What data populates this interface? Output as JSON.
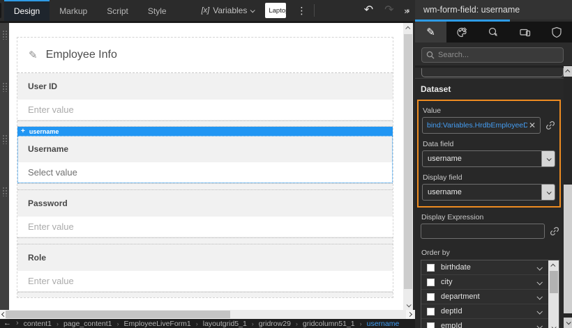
{
  "toolbar": {
    "tabs": [
      {
        "label": "Design",
        "active": true
      },
      {
        "label": "Markup",
        "active": false
      },
      {
        "label": "Script",
        "active": false
      },
      {
        "label": "Style",
        "active": false
      }
    ],
    "variables": {
      "icon_text": "[x]",
      "label": "Variables"
    },
    "device_select": {
      "value": "Laptop with MDPI Screen"
    },
    "icons": [
      "kebab-menu-icon",
      "undo-icon",
      "redo-icon",
      "save-icon",
      "collapse-panel-icon"
    ],
    "undo_glyph": "↶",
    "redo_glyph": "↷",
    "kebab_glyph": "⋮",
    "collapse_glyph": "»"
  },
  "canvas": {
    "form": {
      "title": "Employee Info",
      "selected_tag": "username",
      "fields": [
        {
          "label": "User ID",
          "placeholder": "Enter value"
        },
        {
          "label": "Username",
          "placeholder": "Select value",
          "selected": true
        },
        {
          "label": "Password",
          "placeholder": "Enter value"
        },
        {
          "label": "Role",
          "placeholder": "Enter value"
        }
      ]
    }
  },
  "inspector": {
    "title": "wm-form-field: username",
    "tab_icons": [
      "properties-pencil-icon",
      "styles-palette-icon",
      "events-pointer-icon",
      "device-icon",
      "security-shield-icon"
    ],
    "search_placeholder": "Search...",
    "section_dataset": "Dataset",
    "value_field": {
      "label": "Value",
      "value": "bind:Variables.HrdbEmployeeData.data"
    },
    "data_field": {
      "label": "Data field",
      "value": "username"
    },
    "display_field": {
      "label": "Display field",
      "value": "username"
    },
    "display_expression": {
      "label": "Display Expression",
      "value": ""
    },
    "order_by": {
      "label": "Order by",
      "options": [
        "birthdate",
        "city",
        "department",
        "deptId",
        "empId"
      ]
    }
  },
  "breadcrumb": {
    "back_glyph": "←",
    "forward_glyph": "›",
    "items": [
      "content1",
      "page_content1",
      "EmployeeLiveForm1",
      "layoutgrid5_1",
      "gridrow29",
      "gridcolumn51_1",
      "username"
    ]
  },
  "colors": {
    "accent_orange": "#ee8c21",
    "selection_blue": "#2196f3",
    "bind_text_blue": "#459df2",
    "tab_accent_blue": "#2e9be6"
  }
}
